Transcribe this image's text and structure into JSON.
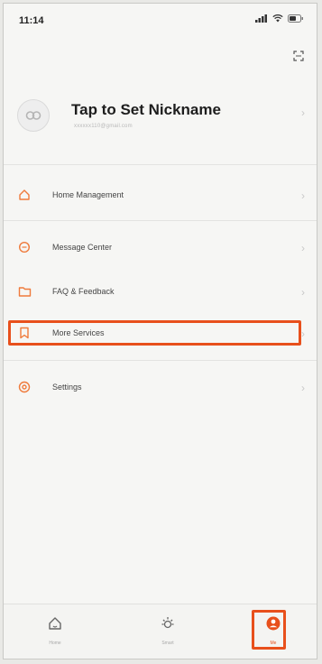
{
  "status_bar": {
    "time": "11:14"
  },
  "profile": {
    "nickname": "Tap to Set Nickname",
    "email": "xxxxxx110@gmail.com"
  },
  "menu": {
    "items": [
      {
        "label": "Home Management",
        "icon": "home-icon"
      },
      {
        "label": "Message Center",
        "icon": "message-icon"
      },
      {
        "label": "FAQ & Feedback",
        "icon": "faq-icon"
      },
      {
        "label": "More Services",
        "icon": "bookmark-icon",
        "highlighted": true
      },
      {
        "label": "Settings",
        "icon": "settings-icon"
      }
    ]
  },
  "tabbar": {
    "tabs": [
      {
        "label": "Home",
        "icon": "home-tab-icon"
      },
      {
        "label": "Smart",
        "icon": "smart-tab-icon"
      },
      {
        "label": "Me",
        "icon": "me-tab-icon",
        "active": true
      }
    ]
  },
  "colors": {
    "accent": "#e8501c",
    "icon_orange": "#ef7a3b",
    "background": "#f6f6f4"
  }
}
